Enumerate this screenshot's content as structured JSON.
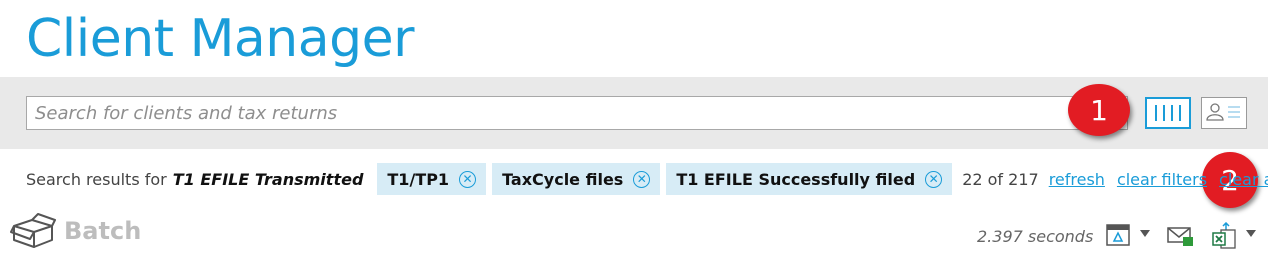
{
  "app": {
    "title": "Client Manager"
  },
  "search": {
    "placeholder": "Search for clients and tax returns"
  },
  "callouts": [
    "1",
    "2"
  ],
  "results": {
    "label": "Search results for",
    "query": "T1 EFILE Transmitted",
    "chips": [
      "T1/TP1",
      "TaxCycle files",
      "T1 EFILE Successfully filed"
    ],
    "count": "22 of 217",
    "links": {
      "refresh": "refresh",
      "clear_filters": "clear filters",
      "clear_all": "clear all"
    }
  },
  "batch": {
    "label": "Batch"
  },
  "status": {
    "seconds": "2.397 seconds"
  },
  "colors": {
    "accent": "#1a9cd8",
    "callout": "#e21c23",
    "chip_bg": "#d7ecf6",
    "email_badge": "#2e9a3a",
    "excel": "#1e7a45"
  },
  "icons": [
    "columns-icon",
    "client-card-icon",
    "box-icon",
    "template-icon",
    "email-icon",
    "excel-export-icon",
    "chevron-down-icon",
    "remove-filter-icon"
  ]
}
